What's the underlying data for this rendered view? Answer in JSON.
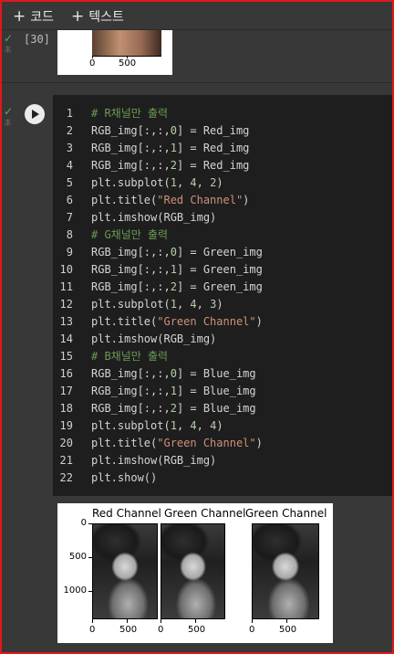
{
  "toolbar": {
    "add_code": "코드",
    "add_text": "텍스트",
    "plus": "+"
  },
  "prev_cell": {
    "exec_count": "[30]",
    "status_sub": "초",
    "x_tick_labels": [
      "0",
      "500"
    ]
  },
  "code_cell": {
    "status_sub": "초",
    "lines": [
      {
        "n": "1",
        "segs": [
          [
            "cmt",
            "# R채널만 출력"
          ]
        ]
      },
      {
        "n": "2",
        "segs": [
          [
            "txt",
            "RGB_img[:,:,"
          ],
          [
            "num",
            "0"
          ],
          [
            "txt",
            "] = Red_img"
          ]
        ]
      },
      {
        "n": "3",
        "segs": [
          [
            "txt",
            "RGB_img[:,:,"
          ],
          [
            "num",
            "1"
          ],
          [
            "txt",
            "] = Red_img"
          ]
        ]
      },
      {
        "n": "4",
        "segs": [
          [
            "txt",
            "RGB_img[:,:,"
          ],
          [
            "num",
            "2"
          ],
          [
            "txt",
            "] = Red_img"
          ]
        ]
      },
      {
        "n": "5",
        "segs": [
          [
            "txt",
            "plt.subplot("
          ],
          [
            "num",
            "1"
          ],
          [
            "txt",
            ", "
          ],
          [
            "num",
            "4"
          ],
          [
            "txt",
            ", "
          ],
          [
            "num",
            "2"
          ],
          [
            "txt",
            ")"
          ]
        ]
      },
      {
        "n": "6",
        "segs": [
          [
            "txt",
            "plt.title("
          ],
          [
            "str",
            "\"Red Channel\""
          ],
          [
            "txt",
            ")"
          ]
        ]
      },
      {
        "n": "7",
        "segs": [
          [
            "txt",
            "plt.imshow(RGB_img)"
          ]
        ]
      },
      {
        "n": "8",
        "segs": [
          [
            "cmt",
            "# G채널만 출력"
          ]
        ]
      },
      {
        "n": "9",
        "segs": [
          [
            "txt",
            "RGB_img[:,:,"
          ],
          [
            "num",
            "0"
          ],
          [
            "txt",
            "] = Green_img"
          ]
        ]
      },
      {
        "n": "10",
        "segs": [
          [
            "txt",
            "RGB_img[:,:,"
          ],
          [
            "num",
            "1"
          ],
          [
            "txt",
            "] = Green_img"
          ]
        ]
      },
      {
        "n": "11",
        "segs": [
          [
            "txt",
            "RGB_img[:,:,"
          ],
          [
            "num",
            "2"
          ],
          [
            "txt",
            "] = Green_img"
          ]
        ]
      },
      {
        "n": "12",
        "segs": [
          [
            "txt",
            "plt.subplot("
          ],
          [
            "num",
            "1"
          ],
          [
            "txt",
            ", "
          ],
          [
            "num",
            "4"
          ],
          [
            "txt",
            ", "
          ],
          [
            "num",
            "3"
          ],
          [
            "txt",
            ")"
          ]
        ]
      },
      {
        "n": "13",
        "segs": [
          [
            "txt",
            "plt.title("
          ],
          [
            "str",
            "\"Green Channel\""
          ],
          [
            "txt",
            ")"
          ]
        ]
      },
      {
        "n": "14",
        "segs": [
          [
            "txt",
            "plt.imshow(RGB_img)"
          ]
        ]
      },
      {
        "n": "15",
        "segs": [
          [
            "cmt",
            "# B채널만 출력"
          ]
        ]
      },
      {
        "n": "16",
        "segs": [
          [
            "txt",
            "RGB_img[:,:,"
          ],
          [
            "num",
            "0"
          ],
          [
            "txt",
            "] = Blue_img"
          ]
        ]
      },
      {
        "n": "17",
        "segs": [
          [
            "txt",
            "RGB_img[:,:,"
          ],
          [
            "num",
            "1"
          ],
          [
            "txt",
            "] = Blue_img"
          ]
        ]
      },
      {
        "n": "18",
        "segs": [
          [
            "txt",
            "RGB_img[:,:,"
          ],
          [
            "num",
            "2"
          ],
          [
            "txt",
            "] = Blue_img"
          ]
        ]
      },
      {
        "n": "19",
        "segs": [
          [
            "txt",
            "plt.subplot("
          ],
          [
            "num",
            "1"
          ],
          [
            "txt",
            ", "
          ],
          [
            "num",
            "4"
          ],
          [
            "txt",
            ", "
          ],
          [
            "num",
            "4"
          ],
          [
            "txt",
            ")"
          ]
        ]
      },
      {
        "n": "20",
        "segs": [
          [
            "txt",
            "plt.title("
          ],
          [
            "str",
            "\"Green Channel\""
          ],
          [
            "txt",
            ")"
          ]
        ]
      },
      {
        "n": "21",
        "segs": [
          [
            "txt",
            "plt.imshow(RGB_img)"
          ]
        ]
      },
      {
        "n": "22",
        "segs": [
          [
            "txt",
            "plt.show()"
          ]
        ]
      }
    ]
  },
  "output": {
    "subplot_titles": [
      "Red Channel",
      "Green Channel",
      "Green Channel"
    ],
    "y_tick_labels": [
      "0",
      "500",
      "1000"
    ],
    "x_tick_labels": [
      "0",
      "500"
    ]
  },
  "colors": {
    "background": "#383838",
    "editor_bg": "#1e1e1e",
    "comment": "#6a9955",
    "number": "#b5cea8",
    "string": "#ce9178",
    "check": "#4caf50",
    "frame": "#e0181c"
  },
  "icons": [
    "plus-icon",
    "check-icon",
    "run-icon"
  ]
}
